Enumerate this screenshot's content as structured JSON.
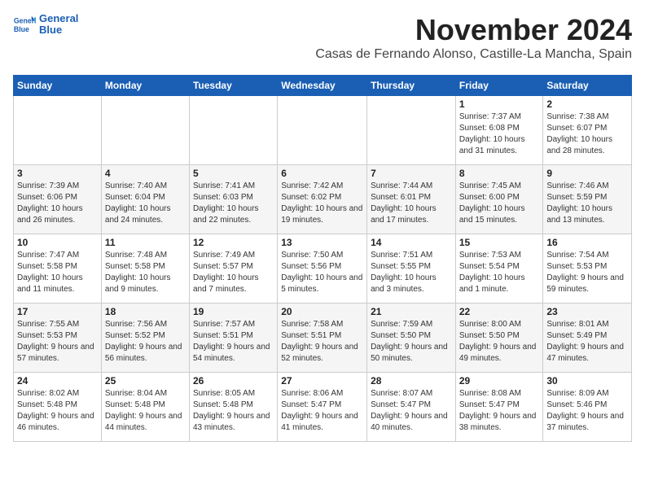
{
  "header": {
    "logo_line1": "General",
    "logo_line2": "Blue",
    "title": "November 2024",
    "location": "Casas de Fernando Alonso, Castille-La Mancha, Spain"
  },
  "columns": [
    "Sunday",
    "Monday",
    "Tuesday",
    "Wednesday",
    "Thursday",
    "Friday",
    "Saturday"
  ],
  "weeks": [
    [
      {
        "day": "",
        "info": ""
      },
      {
        "day": "",
        "info": ""
      },
      {
        "day": "",
        "info": ""
      },
      {
        "day": "",
        "info": ""
      },
      {
        "day": "",
        "info": ""
      },
      {
        "day": "1",
        "info": "Sunrise: 7:37 AM\nSunset: 6:08 PM\nDaylight: 10 hours and 31 minutes."
      },
      {
        "day": "2",
        "info": "Sunrise: 7:38 AM\nSunset: 6:07 PM\nDaylight: 10 hours and 28 minutes."
      }
    ],
    [
      {
        "day": "3",
        "info": "Sunrise: 7:39 AM\nSunset: 6:06 PM\nDaylight: 10 hours and 26 minutes."
      },
      {
        "day": "4",
        "info": "Sunrise: 7:40 AM\nSunset: 6:04 PM\nDaylight: 10 hours and 24 minutes."
      },
      {
        "day": "5",
        "info": "Sunrise: 7:41 AM\nSunset: 6:03 PM\nDaylight: 10 hours and 22 minutes."
      },
      {
        "day": "6",
        "info": "Sunrise: 7:42 AM\nSunset: 6:02 PM\nDaylight: 10 hours and 19 minutes."
      },
      {
        "day": "7",
        "info": "Sunrise: 7:44 AM\nSunset: 6:01 PM\nDaylight: 10 hours and 17 minutes."
      },
      {
        "day": "8",
        "info": "Sunrise: 7:45 AM\nSunset: 6:00 PM\nDaylight: 10 hours and 15 minutes."
      },
      {
        "day": "9",
        "info": "Sunrise: 7:46 AM\nSunset: 5:59 PM\nDaylight: 10 hours and 13 minutes."
      }
    ],
    [
      {
        "day": "10",
        "info": "Sunrise: 7:47 AM\nSunset: 5:58 PM\nDaylight: 10 hours and 11 minutes."
      },
      {
        "day": "11",
        "info": "Sunrise: 7:48 AM\nSunset: 5:58 PM\nDaylight: 10 hours and 9 minutes."
      },
      {
        "day": "12",
        "info": "Sunrise: 7:49 AM\nSunset: 5:57 PM\nDaylight: 10 hours and 7 minutes."
      },
      {
        "day": "13",
        "info": "Sunrise: 7:50 AM\nSunset: 5:56 PM\nDaylight: 10 hours and 5 minutes."
      },
      {
        "day": "14",
        "info": "Sunrise: 7:51 AM\nSunset: 5:55 PM\nDaylight: 10 hours and 3 minutes."
      },
      {
        "day": "15",
        "info": "Sunrise: 7:53 AM\nSunset: 5:54 PM\nDaylight: 10 hours and 1 minute."
      },
      {
        "day": "16",
        "info": "Sunrise: 7:54 AM\nSunset: 5:53 PM\nDaylight: 9 hours and 59 minutes."
      }
    ],
    [
      {
        "day": "17",
        "info": "Sunrise: 7:55 AM\nSunset: 5:53 PM\nDaylight: 9 hours and 57 minutes."
      },
      {
        "day": "18",
        "info": "Sunrise: 7:56 AM\nSunset: 5:52 PM\nDaylight: 9 hours and 56 minutes."
      },
      {
        "day": "19",
        "info": "Sunrise: 7:57 AM\nSunset: 5:51 PM\nDaylight: 9 hours and 54 minutes."
      },
      {
        "day": "20",
        "info": "Sunrise: 7:58 AM\nSunset: 5:51 PM\nDaylight: 9 hours and 52 minutes."
      },
      {
        "day": "21",
        "info": "Sunrise: 7:59 AM\nSunset: 5:50 PM\nDaylight: 9 hours and 50 minutes."
      },
      {
        "day": "22",
        "info": "Sunrise: 8:00 AM\nSunset: 5:50 PM\nDaylight: 9 hours and 49 minutes."
      },
      {
        "day": "23",
        "info": "Sunrise: 8:01 AM\nSunset: 5:49 PM\nDaylight: 9 hours and 47 minutes."
      }
    ],
    [
      {
        "day": "24",
        "info": "Sunrise: 8:02 AM\nSunset: 5:48 PM\nDaylight: 9 hours and 46 minutes."
      },
      {
        "day": "25",
        "info": "Sunrise: 8:04 AM\nSunset: 5:48 PM\nDaylight: 9 hours and 44 minutes."
      },
      {
        "day": "26",
        "info": "Sunrise: 8:05 AM\nSunset: 5:48 PM\nDaylight: 9 hours and 43 minutes."
      },
      {
        "day": "27",
        "info": "Sunrise: 8:06 AM\nSunset: 5:47 PM\nDaylight: 9 hours and 41 minutes."
      },
      {
        "day": "28",
        "info": "Sunrise: 8:07 AM\nSunset: 5:47 PM\nDaylight: 9 hours and 40 minutes."
      },
      {
        "day": "29",
        "info": "Sunrise: 8:08 AM\nSunset: 5:47 PM\nDaylight: 9 hours and 38 minutes."
      },
      {
        "day": "30",
        "info": "Sunrise: 8:09 AM\nSunset: 5:46 PM\nDaylight: 9 hours and 37 minutes."
      }
    ]
  ]
}
